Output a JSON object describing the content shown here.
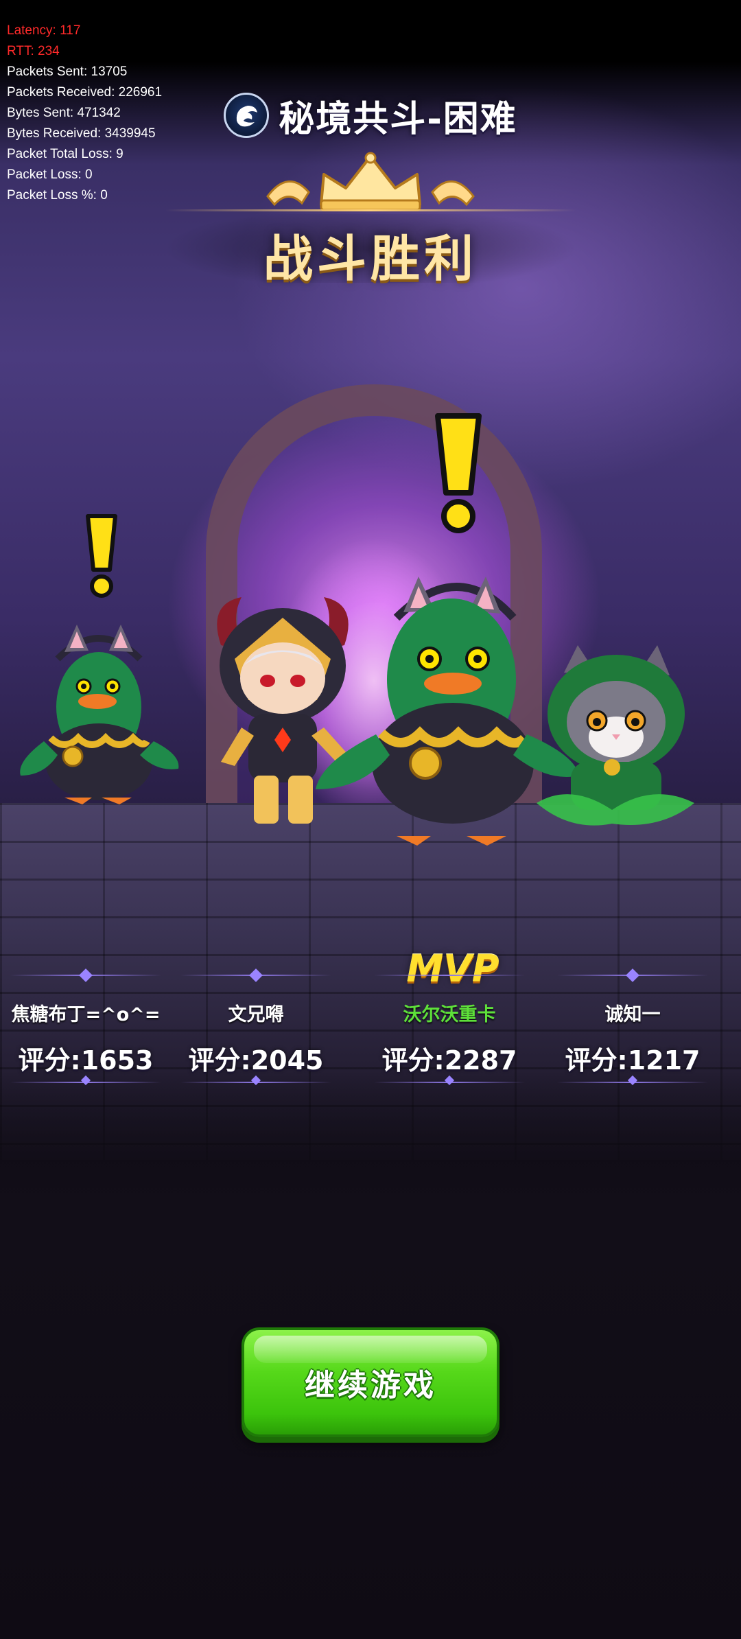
{
  "debug": {
    "latency": "Latency: 117",
    "rtt": "RTT: 234",
    "packets_sent": "Packets Sent: 13705",
    "packets_received": "Packets Received: 226961",
    "bytes_sent": "Bytes Sent: 471342",
    "bytes_received": "Bytes Received: 3439945",
    "packet_total_loss": "Packet Total Loss: 9",
    "packet_loss": "Packet Loss: 0",
    "packet_loss_pct": "Packet Loss %: 0"
  },
  "header": {
    "mode_title": "秘境共斗-困难",
    "mode_icon": "dragon-emblem-icon",
    "result_title": "战斗胜利",
    "crown_icon": "crown-icon"
  },
  "mvp_label": "MVP",
  "players": [
    {
      "name": "焦糖布丁=^o^=",
      "score": "评分:1653",
      "character": "green-duck-cat-hat",
      "mvp": false
    },
    {
      "name": "文兄嘚",
      "score": "评分:2045",
      "character": "horned-hooded-warrior",
      "mvp": false
    },
    {
      "name": "沃尔沃重卡",
      "score": "评分:2287",
      "character": "green-duck-cat-hat",
      "mvp": true
    },
    {
      "name": "诚知一",
      "score": "评分:1217",
      "character": "hooded-cat",
      "mvp": false
    }
  ],
  "continue_button": {
    "label": "继续游戏"
  },
  "colors": {
    "mvp_name": "#5ee03a",
    "mvp_badge": "#ffdf2e",
    "button_green": "#4fd414",
    "debug_warning": "#ff2a2a",
    "victory_text": "#ffe6a6"
  }
}
